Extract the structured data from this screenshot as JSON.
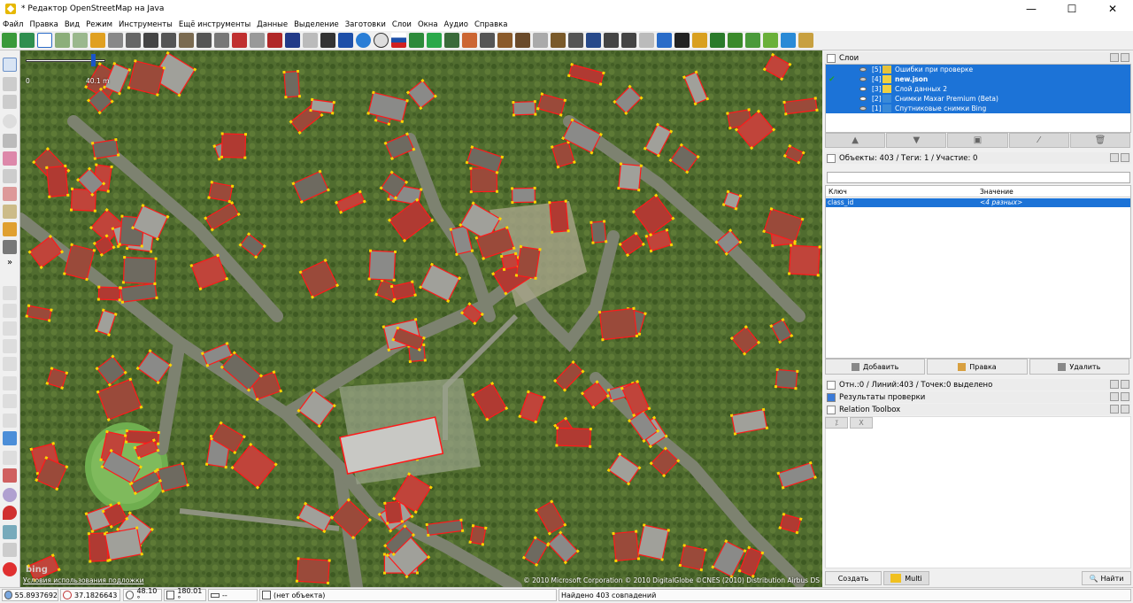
{
  "window": {
    "title": "* Редактор OpenStreetMap на Java",
    "minimize": "—",
    "maximize": "☐",
    "close": "✕"
  },
  "menu": [
    "Файл",
    "Правка",
    "Вид",
    "Режим",
    "Инструменты",
    "Ещё инструменты",
    "Данные",
    "Выделение",
    "Заготовки",
    "Слои",
    "Окна",
    "Аудио",
    "Справка"
  ],
  "map": {
    "scale_left": "0",
    "scale_right": "40.1 m",
    "copyright": "© 2010 Microsoft Corporation © 2010 DigitalGlobe ©CNES (2010) Distribution Airbus DS",
    "terms": "Условия использования подложки",
    "provider_logo": "bing"
  },
  "layers_panel": {
    "title": "Слои",
    "layers": [
      {
        "index": "[5]",
        "name": "Ошибки при проверке",
        "active": false,
        "bold": false,
        "icon": "validator-icon"
      },
      {
        "index": "[4]",
        "name": "new.json",
        "active": true,
        "bold": true,
        "icon": "data-layer-icon"
      },
      {
        "index": "[3]",
        "name": "Слой данных 2",
        "active": false,
        "bold": false,
        "icon": "data-layer-icon"
      },
      {
        "index": "[2]",
        "name": "Снимки Maxar Premium (Beta)",
        "active": false,
        "bold": false,
        "icon": "imagery-icon"
      },
      {
        "index": "[1]",
        "name": "Спутниковые снимки Bing",
        "active": false,
        "bold": false,
        "icon": "imagery-icon"
      }
    ]
  },
  "properties_panel": {
    "title": "Объекты: 403 / Теги: 1 / Участие: 0",
    "col_key": "Ключ",
    "col_value": "Значение",
    "rows": [
      {
        "key": "class_id",
        "value": "<4 разных>"
      }
    ],
    "add": "Добавить",
    "edit": "Правка",
    "delete": "Удалить"
  },
  "relations_panel": {
    "title": "Отн.:0 / Линий:403 / Точек:0 выделено"
  },
  "validation_panel": {
    "title": "Результаты проверки"
  },
  "relation_toolbox": {
    "title": "Relation Toolbox"
  },
  "bottom_buttons": {
    "create": "Создать",
    "multi": "Multi",
    "find": "Найти"
  },
  "status": {
    "lat": "55.8937692",
    "lon": "37.1826643",
    "heading": "48.10 °",
    "angle": "180.01 °",
    "distance": "--",
    "object": "(нет объекта)",
    "found": "Найдено 403 совпадений"
  }
}
